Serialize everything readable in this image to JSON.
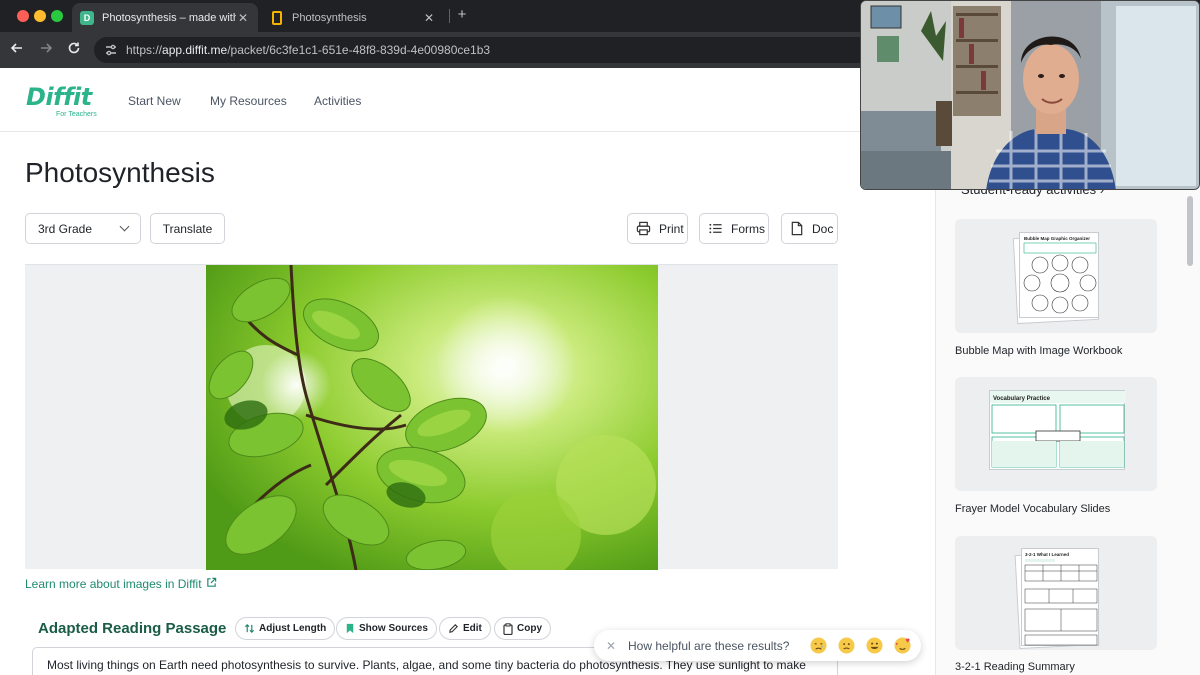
{
  "browser": {
    "tabs": [
      {
        "title": "Photosynthesis – made with Diffit",
        "active": true
      },
      {
        "title": "Photosynthesis",
        "active": false
      }
    ],
    "url_prefix": "https://",
    "url_host": "app.diffit.me",
    "url_path": "/packet/6c3fe1c1-651e-48f8-839d-4e00980ce1b3"
  },
  "header": {
    "logo": "Diffit",
    "logo_sub": "For Teachers",
    "nav": [
      "Start New",
      "My Resources",
      "Activities"
    ]
  },
  "main": {
    "title": "Photosynthesis",
    "grade_select": "3rd Grade",
    "translate_label": "Translate",
    "print_label": "Print",
    "forms_label": "Forms",
    "doc_label": "Doc",
    "learn_link": "Learn more about images in Diffit",
    "section_title": "Adapted Reading Passage",
    "pills": {
      "adjust": "Adjust Length",
      "sources": "Show Sources",
      "edit": "Edit",
      "copy": "Copy"
    },
    "passage": "Most living things on Earth need photosynthesis to survive. Plants, algae, and some tiny bacteria do photosynthesis. They use sunlight to make"
  },
  "feedback": {
    "question": "How helpful are these results?"
  },
  "right_panel": {
    "heading": "Student-ready activities ›",
    "activities": [
      {
        "label": "Bubble Map with Image Workbook",
        "thumb_title": "Bubble Map Graphic Organizer"
      },
      {
        "label": "Frayer Model Vocabulary Slides",
        "thumb_title": "Vocabulary Practice"
      },
      {
        "label": "3-2-1 Reading Summary",
        "thumb_title": "3-2-1 What I Learned"
      }
    ]
  },
  "colors": {
    "brand": "#2bb38a",
    "section_title": "#1a5c45",
    "link": "#1f8a70"
  }
}
